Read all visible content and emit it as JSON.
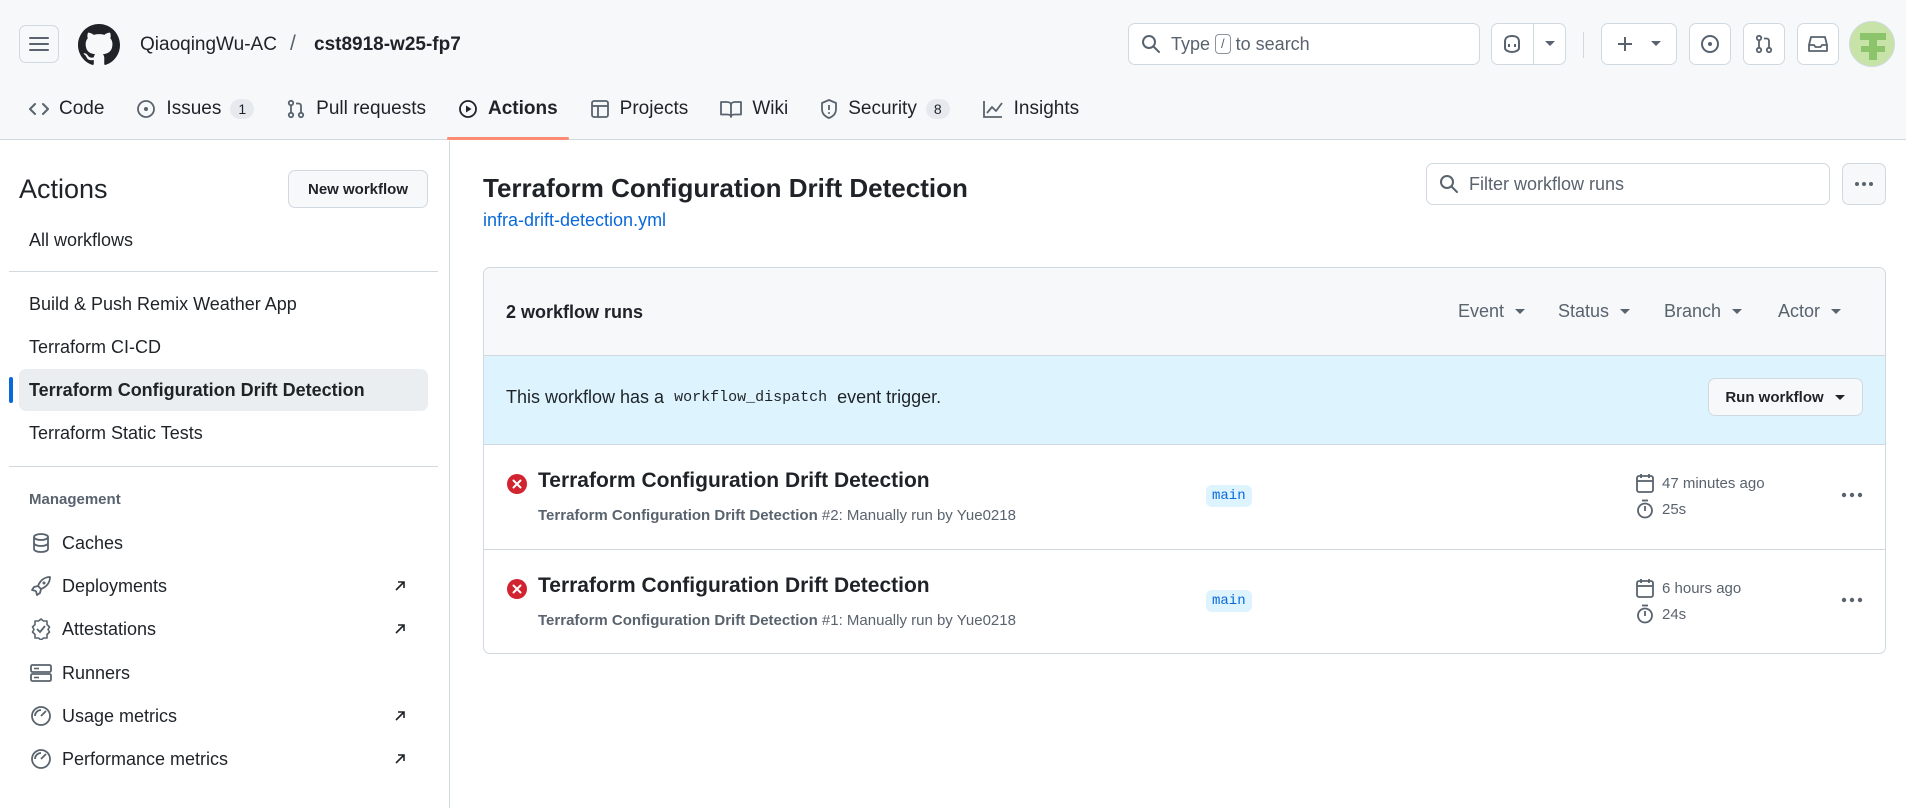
{
  "header": {
    "owner": "QiaoqingWu-AC",
    "separator": "/",
    "repo": "cst8918-w25-fp7",
    "search_prefix": "Type",
    "search_key": "/",
    "search_suffix": "to search"
  },
  "tabs": [
    {
      "label": "Code",
      "icon": "code-icon"
    },
    {
      "label": "Issues",
      "icon": "issue-opened-icon",
      "count": "1"
    },
    {
      "label": "Pull requests",
      "icon": "git-pull-request-icon"
    },
    {
      "label": "Actions",
      "icon": "play-icon",
      "active": true
    },
    {
      "label": "Projects",
      "icon": "table-icon"
    },
    {
      "label": "Wiki",
      "icon": "book-icon"
    },
    {
      "label": "Security",
      "icon": "shield-icon",
      "count": "8"
    },
    {
      "label": "Insights",
      "icon": "graph-icon"
    }
  ],
  "sidebar": {
    "title": "Actions",
    "new_workflow": "New workflow",
    "all_workflows": "All workflows",
    "workflows": [
      "Build & Push Remix Weather App",
      "Terraform CI-CD",
      "Terraform Configuration Drift Detection",
      "Terraform Static Tests"
    ],
    "management_heading": "Management",
    "management": [
      {
        "label": "Caches",
        "icon": "database-icon"
      },
      {
        "label": "Deployments",
        "icon": "rocket-icon"
      },
      {
        "label": "Attestations",
        "icon": "verified-icon"
      },
      {
        "label": "Runners",
        "icon": "server-icon"
      },
      {
        "label": "Usage metrics",
        "icon": "meter-icon"
      },
      {
        "label": "Performance metrics",
        "icon": "meter-icon"
      }
    ]
  },
  "main": {
    "title": "Terraform Configuration Drift Detection",
    "file": "infra-drift-detection.yml",
    "filter_placeholder": "Filter workflow runs",
    "runs_count": "2 workflow runs",
    "filters": [
      "Event",
      "Status",
      "Branch",
      "Actor"
    ],
    "dispatch_before": "This workflow has a",
    "dispatch_code": "workflow_dispatch",
    "dispatch_after": "event trigger.",
    "run_workflow": "Run workflow",
    "runs": [
      {
        "title": "Terraform Configuration Drift Detection",
        "workflow": "Terraform Configuration Drift Detection",
        "detail": "#2: Manually run by Yue0218",
        "branch": "main",
        "time": "47 minutes ago",
        "duration": "25s",
        "status": "failure"
      },
      {
        "title": "Terraform Configuration Drift Detection",
        "workflow": "Terraform Configuration Drift Detection",
        "detail": "#1: Manually run by Yue0218",
        "branch": "main",
        "time": "6 hours ago",
        "duration": "24s",
        "status": "failure"
      }
    ]
  },
  "colors": {
    "accent": "#0969da",
    "tab_underline": "#fd8c73",
    "failure": "#d1242f",
    "dispatch_bg": "#ddf4ff"
  }
}
